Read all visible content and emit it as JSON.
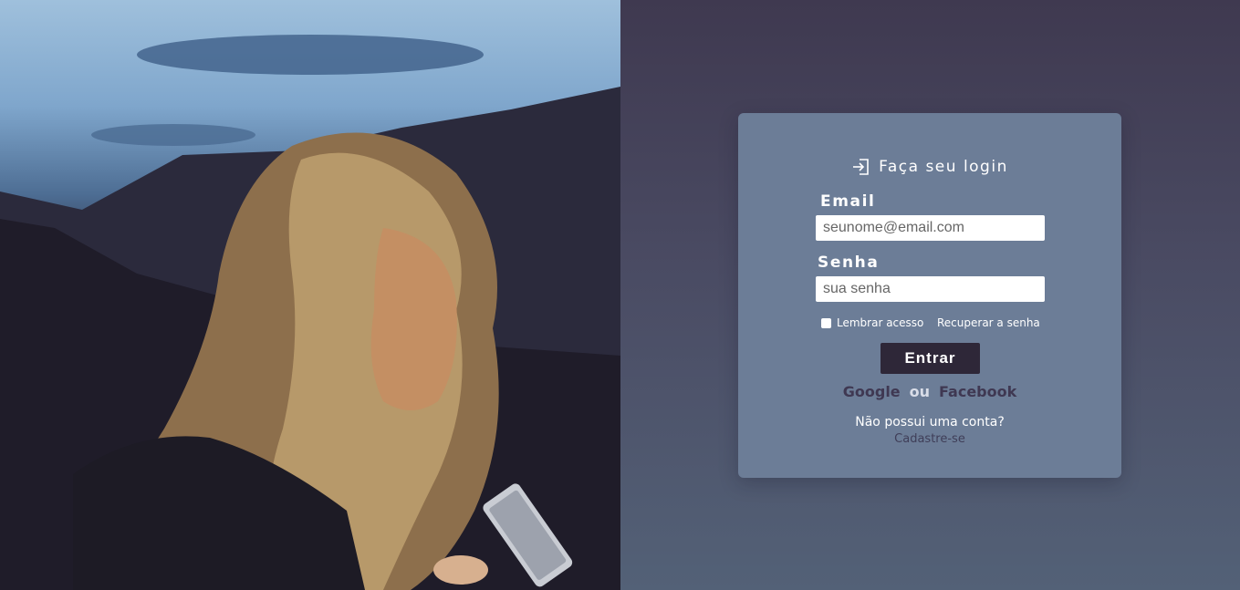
{
  "login": {
    "title": "Faça seu login",
    "email_label": "Email",
    "email_placeholder": "seunome@email.com",
    "password_label": "Senha",
    "password_placeholder": "sua senha",
    "remember_label": "Lembrar acesso",
    "recover_link": "Recuperar a senha",
    "submit_label": "Entrar",
    "google_label": "Google",
    "or_label": "ou",
    "facebook_label": "Facebook",
    "no_account_text": "Não possui uma conta?",
    "signup_link": "Cadastre-se"
  },
  "icons": {
    "login_icon": "login-arrow-icon"
  },
  "colors": {
    "card_bg": "#6c7d97",
    "button_bg": "#2e2738",
    "page_bg": "#3f3950"
  }
}
